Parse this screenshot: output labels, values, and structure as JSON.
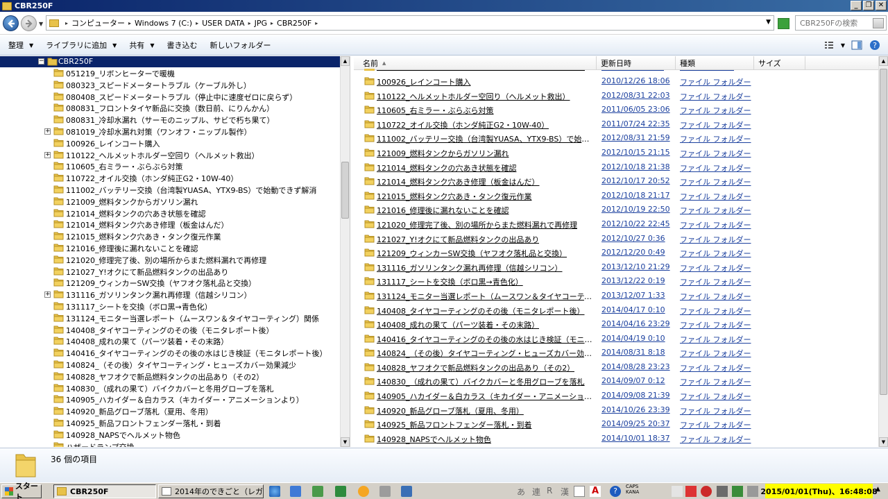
{
  "window": {
    "title": "CBR250F"
  },
  "address": {
    "breadcrumbs": [
      "コンピューター",
      "Windows 7 (C:)",
      "USER DATA",
      "JPG",
      "CBR250F"
    ]
  },
  "search": {
    "placeholder": "CBR250Fの検索"
  },
  "toolbar": {
    "organize": "整理",
    "add_to_library": "ライブラリに追加",
    "share": "共有",
    "burn": "書き込む",
    "new_folder": "新しいフォルダー"
  },
  "tree": {
    "root_label": "CBR250F",
    "items": [
      {
        "label": "051219_リボンヒーターで暖機",
        "expandable": false
      },
      {
        "label": "080323_スピードメータートラブル（ケーブル外し）",
        "expandable": false
      },
      {
        "label": "080408_スピードメータートラブル（停止中に速度ゼロに戻らず）",
        "expandable": false
      },
      {
        "label": "080831_フロントタイヤ新品に交換（数日前、にりんかん）",
        "expandable": false
      },
      {
        "label": "080831_冷却水漏れ（サーモのニップル、サビで朽ち果て）",
        "expandable": false
      },
      {
        "label": "081019_冷却水漏れ対策（ワンオフ・ニップル製作）",
        "expandable": true
      },
      {
        "label": "100926_レインコート購入",
        "expandable": false
      },
      {
        "label": "110122_ヘルメットホルダー空回り（ヘルメット救出）",
        "expandable": true
      },
      {
        "label": "110605_右ミラー・ぶらぶら対策",
        "expandable": false
      },
      {
        "label": "110722_オイル交換（ホンダ純正G2・10W-40）",
        "expandable": false
      },
      {
        "label": "111002_バッテリー交換（台湾製YUASA、YTX9-BS）で始動できず解消",
        "expandable": false
      },
      {
        "label": "121009_燃料タンクからガソリン漏れ",
        "expandable": false
      },
      {
        "label": "121014_燃料タンクの穴あき状態を確認",
        "expandable": false
      },
      {
        "label": "121014_燃料タンク穴あき修理（板金はんだ）",
        "expandable": false
      },
      {
        "label": "121015_燃料タンク穴あき・タンク復元作業",
        "expandable": false
      },
      {
        "label": "121016_修理後に漏れないことを確認",
        "expandable": false
      },
      {
        "label": "121020_修理完了後、別の場所からまた燃料漏れで再修理",
        "expandable": false
      },
      {
        "label": "121027_Y!オクにて新品燃料タンクの出品あり",
        "expandable": false
      },
      {
        "label": "121209_ウィンカーSW交換（ヤフオク落札品と交換）",
        "expandable": false
      },
      {
        "label": "131116_ガソリンタンク漏れ再修理（信越シリコン）",
        "expandable": true
      },
      {
        "label": "131117_シートを交換（ボロ黒→青色化）",
        "expandable": false
      },
      {
        "label": "131124_モニター当選レポート（ムースワン＆タイヤコーティング）関係",
        "expandable": false
      },
      {
        "label": "140408_タイヤコーティングのその後（モニタレポート後）",
        "expandable": false
      },
      {
        "label": "140408_成れの果て（パーツ装着・その末路）",
        "expandable": false
      },
      {
        "label": "140416_タイヤコーティングのその後の水はじき検証（モニタレポート後）",
        "expandable": false
      },
      {
        "label": "140824_（その後）タイヤコーティング・ヒューズカバー効果減少",
        "expandable": false
      },
      {
        "label": "140828_ヤフオクで新品燃料タンクの出品あり（その2）",
        "expandable": false
      },
      {
        "label": "140830_（成れの果て）バイクカバーと冬用グローブを落札",
        "expandable": false
      },
      {
        "label": "140905_ハカイダー＆白カラス（キカイダー・アニメーションより）",
        "expandable": false
      },
      {
        "label": "140920_新品グローブ落札（夏用、冬用）",
        "expandable": false
      },
      {
        "label": "140925_新品フロントフェンダー落札・到着",
        "expandable": false
      },
      {
        "label": "140928_NAPSでヘルメット物色",
        "expandable": false
      },
      {
        "label": "ハザードランプ交換",
        "expandable": false
      }
    ]
  },
  "list": {
    "columns": {
      "name": "名前",
      "date": "更新日時",
      "type": "種類",
      "size": "サイズ"
    },
    "rows": [
      {
        "name": "100926_レインコート購入",
        "date": "2010/12/26 18:06",
        "type": "ファイル フォルダー"
      },
      {
        "name": "110122_ヘルメットホルダー空回り（ヘルメット救出）",
        "date": "2012/08/31 22:03",
        "type": "ファイル フォルダー"
      },
      {
        "name": "110605_右ミラー・ぶらぶら対策",
        "date": "2011/06/05 23:06",
        "type": "ファイル フォルダー"
      },
      {
        "name": "110722_オイル交換（ホンダ純正G2・10W-40）",
        "date": "2011/07/24 22:35",
        "type": "ファイル フォルダー"
      },
      {
        "name": "111002_バッテリー交換（台湾製YUASA、YTX9-BS）で始動できず解...",
        "date": "2012/08/31 21:59",
        "type": "ファイル フォルダー"
      },
      {
        "name": "121009_燃料タンクからガソリン漏れ",
        "date": "2012/10/15 21:15",
        "type": "ファイル フォルダー"
      },
      {
        "name": "121014_燃料タンクの穴あき状態を確認",
        "date": "2012/10/18 21:38",
        "type": "ファイル フォルダー"
      },
      {
        "name": "121014_燃料タンク穴あき修理（板金はんだ）",
        "date": "2012/10/17 20:52",
        "type": "ファイル フォルダー"
      },
      {
        "name": "121015_燃料タンク穴あき・タンク復元作業",
        "date": "2012/10/18 21:17",
        "type": "ファイル フォルダー"
      },
      {
        "name": "121016_修理後に漏れないことを確認",
        "date": "2012/10/19 22:50",
        "type": "ファイル フォルダー"
      },
      {
        "name": "121020_修理完了後、別の場所からまた燃料漏れで再修理",
        "date": "2012/10/22 22:45",
        "type": "ファイル フォルダー"
      },
      {
        "name": "121027_Y!オクにて新品燃料タンクの出品あり",
        "date": "2012/10/27 0:36",
        "type": "ファイル フォルダー"
      },
      {
        "name": "121209_ウィンカーSW交換（ヤフオク落札品と交換）",
        "date": "2012/12/20 0:49",
        "type": "ファイル フォルダー"
      },
      {
        "name": "131116_ガソリンタンク漏れ再修理（信越シリコン）",
        "date": "2013/12/10 21:29",
        "type": "ファイル フォルダー"
      },
      {
        "name": "131117_シートを交換（ボロ黒→青色化）",
        "date": "2013/12/22 0:19",
        "type": "ファイル フォルダー"
      },
      {
        "name": "131124_モニター当選レポート（ムースワン＆タイヤコーティング）関係",
        "date": "2013/12/07 1:33",
        "type": "ファイル フォルダー"
      },
      {
        "name": "140408_タイヤコーティングのその後（モニタレポート後）",
        "date": "2014/04/17 0:10",
        "type": "ファイル フォルダー"
      },
      {
        "name": "140408_成れの果て（パーツ装着・その末路）",
        "date": "2014/04/16 23:29",
        "type": "ファイル フォルダー"
      },
      {
        "name": "140416_タイヤコーティングのその後の水はじき検証（モニタレポート後）",
        "date": "2014/04/19 0:10",
        "type": "ファイル フォルダー"
      },
      {
        "name": "140824_（その後）タイヤコーティング・ヒューズカバー効果減少",
        "date": "2014/08/31 8:18",
        "type": "ファイル フォルダー"
      },
      {
        "name": "140828_ヤフオクで新品燃料タンクの出品あり（その2）",
        "date": "2014/08/28 23:23",
        "type": "ファイル フォルダー"
      },
      {
        "name": "140830_（成れの果て）バイクカバーと冬用グローブを落札",
        "date": "2014/09/07 0:12",
        "type": "ファイル フォルダー"
      },
      {
        "name": "140905_ハカイダー＆白カラス（キカイダー・アニメーションより）",
        "date": "2014/09/08 21:39",
        "type": "ファイル フォルダー"
      },
      {
        "name": "140920_新品グローブ落札（夏用、冬用）",
        "date": "2014/10/26 23:39",
        "type": "ファイル フォルダー"
      },
      {
        "name": "140925_新品フロントフェンダー落札・到着",
        "date": "2014/09/25 20:37",
        "type": "ファイル フォルダー"
      },
      {
        "name": "140928_NAPSでヘルメット物色",
        "date": "2014/10/01 18:37",
        "type": "ファイル フォルダー"
      }
    ]
  },
  "details": {
    "item_count": "36 個の項目"
  },
  "taskbar": {
    "start_label": "スタート",
    "active_task": "CBR250F",
    "other_task": "2014年のできごと（レガシィ...",
    "ime": [
      "あ",
      "連",
      "R",
      "漢"
    ],
    "caps": "CAPS",
    "kana": "KANA",
    "clock": "2015/01/01(Thu)、16:48:08"
  },
  "colors": {
    "title_bar": "#0a246a",
    "selection": "#0a246a",
    "link_text": "#1a3f9e",
    "folder": "#e8c24a",
    "clock_bg": "#ffff00"
  }
}
